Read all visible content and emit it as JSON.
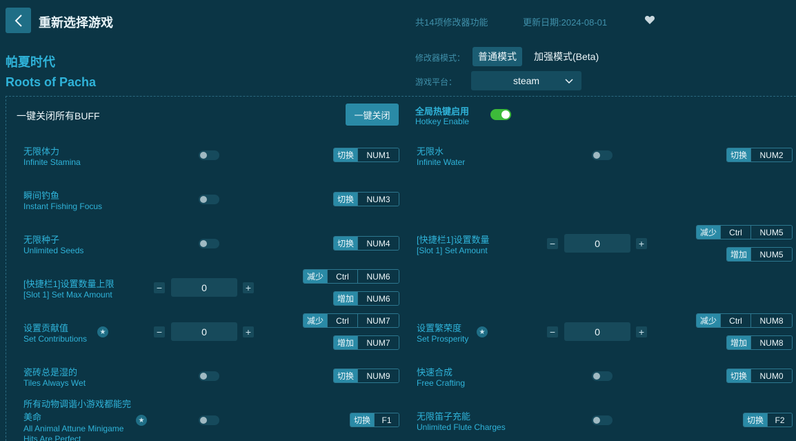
{
  "header": {
    "title": "重新选择游戏",
    "feature_count": "共14项修改器功能",
    "update_date": "更新日期:2024-08-01"
  },
  "game": {
    "name_cn": "帕夏时代",
    "name_en": "Roots of Pacha"
  },
  "mode": {
    "label": "修改器模式：",
    "normal": "普通模式",
    "enhanced": "加强模式(Beta)"
  },
  "platform": {
    "label": "游戏平台：",
    "value": "steam"
  },
  "buff": {
    "label": "一键关闭所有BUFF",
    "button": "一键关闭"
  },
  "hotkey": {
    "label_cn": "全局热键启用",
    "label_en": "Hotkey Enable"
  },
  "labels": {
    "toggle": "切换",
    "decrease": "减少",
    "increase": "增加",
    "ctrl": "Ctrl"
  },
  "options": [
    {
      "cn": "无限体力",
      "en": "Infinite Stamina",
      "key": "NUM1"
    },
    {
      "cn": "无限水",
      "en": "Infinite Water",
      "key": "NUM2"
    },
    {
      "cn": "瞬间钓鱼",
      "en": "Instant Fishing Focus",
      "key": "NUM3"
    },
    {
      "cn": "无限种子",
      "en": "Unlimited Seeds",
      "key": "NUM4"
    },
    {
      "cn": "[快捷栏1]设置数量",
      "en": "[Slot 1] Set Amount",
      "value": "0",
      "dec_key": "NUM5",
      "inc_key": "NUM5"
    },
    {
      "cn": "[快捷栏1]设置数量上限",
      "en": "[Slot 1] Set Max Amount",
      "value": "0",
      "dec_key": "NUM6",
      "inc_key": "NUM6"
    },
    {
      "cn": "设置贡献值",
      "en": "Set Contributions",
      "value": "0",
      "dec_key": "NUM7",
      "inc_key": "NUM7"
    },
    {
      "cn": "设置繁荣度",
      "en": "Set Prosperity",
      "value": "0",
      "dec_key": "NUM8",
      "inc_key": "NUM8"
    },
    {
      "cn": "瓷砖总是湿的",
      "en": "Tiles Always Wet",
      "key": "NUM9"
    },
    {
      "cn": "快速合成",
      "en": "Free Crafting",
      "key": "NUM0"
    },
    {
      "cn": "所有动物调谐小游戏都能完美命",
      "en": "All Animal Attune Minigame Hits Are Perfect",
      "key": "F1"
    },
    {
      "cn": "无限笛子充能",
      "en": "Unlimited Flute Charges",
      "key": "F2"
    }
  ]
}
